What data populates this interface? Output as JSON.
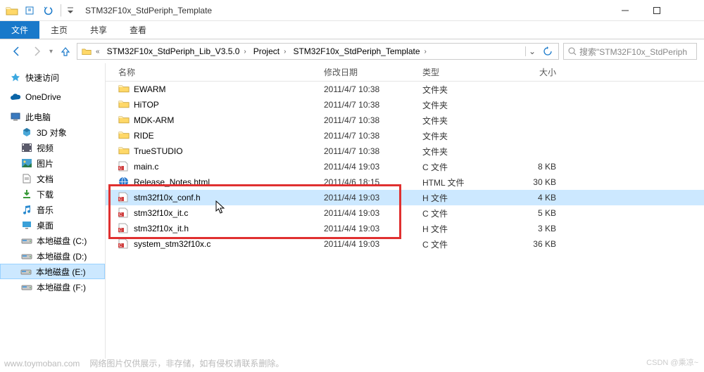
{
  "titlebar": {
    "title": "STM32F10x_StdPeriph_Template"
  },
  "tabs": {
    "file": "文件",
    "home": "主页",
    "share": "共享",
    "view": "查看"
  },
  "breadcrumb": {
    "segments": [
      "STM32F10x_StdPeriph_Lib_V3.5.0",
      "Project",
      "STM32F10x_StdPeriph_Template"
    ]
  },
  "search": {
    "placeholder": "搜索\"STM32F10x_StdPeriph"
  },
  "sidebar": {
    "quick_access": "快速访问",
    "onedrive": "OneDrive",
    "this_pc": "此电脑",
    "pc_children": [
      "3D 对象",
      "视频",
      "图片",
      "文档",
      "下载",
      "音乐",
      "桌面",
      "本地磁盘 (C:)",
      "本地磁盘 (D:)",
      "本地磁盘 (E:)",
      "本地磁盘 (F:)"
    ]
  },
  "columns": {
    "name": "名称",
    "date": "修改日期",
    "type": "类型",
    "size": "大小"
  },
  "files": [
    {
      "name": "EWARM",
      "date": "2011/4/7 10:38",
      "type": "文件夹",
      "size": "",
      "icon": "folder"
    },
    {
      "name": "HiTOP",
      "date": "2011/4/7 10:38",
      "type": "文件夹",
      "size": "",
      "icon": "folder"
    },
    {
      "name": "MDK-ARM",
      "date": "2011/4/7 10:38",
      "type": "文件夹",
      "size": "",
      "icon": "folder"
    },
    {
      "name": "RIDE",
      "date": "2011/4/7 10:38",
      "type": "文件夹",
      "size": "",
      "icon": "folder"
    },
    {
      "name": "TrueSTUDIO",
      "date": "2011/4/7 10:38",
      "type": "文件夹",
      "size": "",
      "icon": "folder"
    },
    {
      "name": "main.c",
      "date": "2011/4/4 19:03",
      "type": "C 文件",
      "size": "8 KB",
      "icon": "cfile"
    },
    {
      "name": "Release_Notes.html",
      "date": "2011/4/6 18:15",
      "type": "HTML 文件",
      "size": "30 KB",
      "icon": "html"
    },
    {
      "name": "stm32f10x_conf.h",
      "date": "2011/4/4 19:03",
      "type": "H 文件",
      "size": "4 KB",
      "icon": "cfile",
      "selected": true
    },
    {
      "name": "stm32f10x_it.c",
      "date": "2011/4/4 19:03",
      "type": "C 文件",
      "size": "5 KB",
      "icon": "cfile"
    },
    {
      "name": "stm32f10x_it.h",
      "date": "2011/4/4 19:03",
      "type": "H 文件",
      "size": "3 KB",
      "icon": "cfile"
    },
    {
      "name": "system_stm32f10x.c",
      "date": "2011/4/4 19:03",
      "type": "C 文件",
      "size": "36 KB",
      "icon": "cfile"
    }
  ],
  "selected_sidebar_index": 9,
  "footer": {
    "host": "www.toymoban.com",
    "note": "网络图片仅供展示，非存储，如有侵权请联系删除。",
    "csdn": "CSDN @乘凉~"
  }
}
